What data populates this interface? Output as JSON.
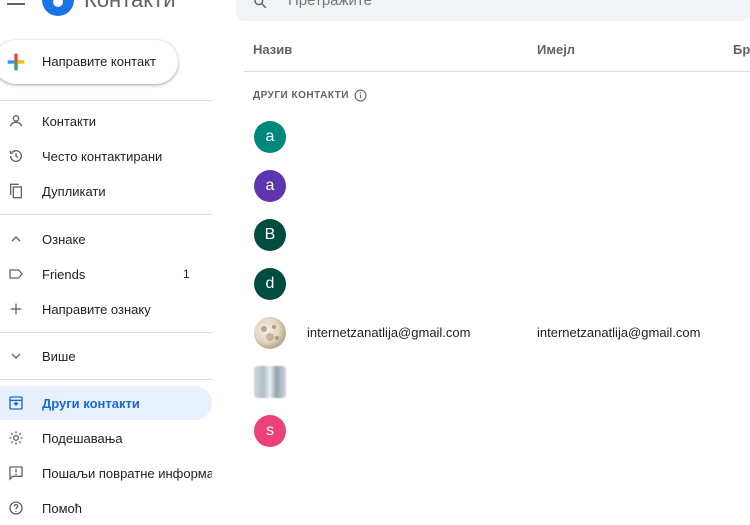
{
  "app": {
    "title": "Контакти"
  },
  "search": {
    "placeholder": "Претражите"
  },
  "create_button": {
    "label": "Направите контакт"
  },
  "sidebar": {
    "items": [
      {
        "label": "Контакти",
        "icon": "person-icon"
      },
      {
        "label": "Често контактирани",
        "icon": "history-icon"
      },
      {
        "label": "Дупликати",
        "icon": "copy-icon"
      },
      {
        "label": "Ознаке",
        "icon": "chevron-up-icon"
      },
      {
        "label": "Friends",
        "icon": "label-icon",
        "count": "1"
      },
      {
        "label": "Направите ознаку",
        "icon": "plus-icon"
      },
      {
        "label": "Више",
        "icon": "chevron-down-icon"
      },
      {
        "label": "Други контакти",
        "icon": "archive-icon",
        "active": true
      },
      {
        "label": "Подешавања",
        "icon": "gear-icon"
      },
      {
        "label": "Пошаљи повратне информа",
        "icon": "feedback-icon"
      },
      {
        "label": "Помоћ",
        "icon": "help-icon"
      }
    ]
  },
  "table": {
    "columns": [
      "Назив",
      "Имејл",
      "Бро"
    ],
    "section_title": "ДРУГИ КОНТАКТИ",
    "rows": [
      {
        "initial": "a",
        "color": "#00897b",
        "name": "",
        "email": ""
      },
      {
        "initial": "a",
        "color": "#5e35b1",
        "name": "",
        "email": ""
      },
      {
        "initial": "B",
        "color": "#004d40",
        "name": "",
        "email": ""
      },
      {
        "initial": "d",
        "color": "#004d40",
        "name": "",
        "email": ""
      },
      {
        "initial": "",
        "color": "#d7ccc8",
        "name": "internetzanatlija@gmail.com",
        "email": "internetzanatlija@gmail.com",
        "photo": true
      },
      {
        "initial": "",
        "color": "#b0bec5",
        "name": "",
        "email": "",
        "blurred": true
      },
      {
        "initial": "s",
        "color": "#ec407a",
        "name": "",
        "email": ""
      }
    ]
  },
  "colors": {
    "accent": "#1a73e8",
    "active_bg": "#e8f0fe",
    "active_text": "#1967d2"
  }
}
